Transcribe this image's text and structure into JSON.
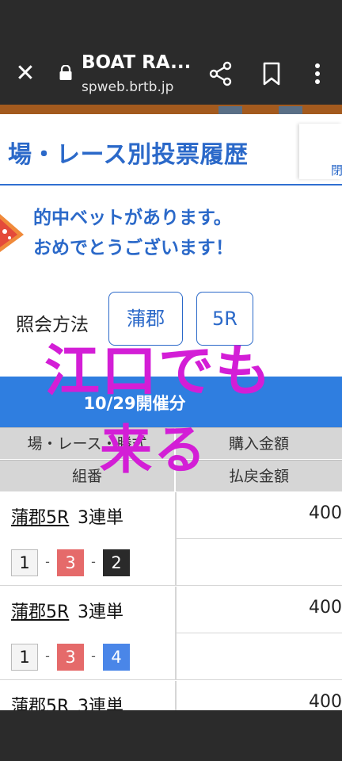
{
  "browser": {
    "title": "BOAT RA...",
    "url": "spweb.brtb.jp",
    "close_icon": "close-icon",
    "lock_icon": "lock-icon",
    "share_icon": "share-icon",
    "bookmark_icon": "bookmark-icon",
    "menu_icon": "more-vert-icon"
  },
  "page": {
    "title": "場・レース別投票履歴",
    "header_right_text": "閉"
  },
  "hit_message": {
    "line1": "的中ベットがあります。",
    "line2": "おめでとうございます！"
  },
  "query": {
    "label": "照会方法",
    "venue": "蒲郡",
    "race": "5R"
  },
  "date_bar": {
    "text": "10/29開催分"
  },
  "table": {
    "header_row1": {
      "left": "場・レース・勝式",
      "right": "購入金額"
    },
    "header_row2": {
      "left": "組番",
      "right": "払戻金額"
    },
    "rows": [
      {
        "race": "蒲郡5R",
        "bet_type": "3連単",
        "amount": "400",
        "combo": [
          "1",
          "3",
          "2"
        ]
      },
      {
        "race": "蒲郡5R",
        "bet_type": "3連単",
        "amount": "400",
        "combo": [
          "1",
          "3",
          "4"
        ]
      },
      {
        "race": "蒲郡5R",
        "bet_type": "3連単",
        "amount": "400"
      }
    ]
  },
  "overlay_text": {
    "line1": "江口でも",
    "line2": "来る"
  },
  "colors": {
    "accent_blue": "#2b69c9",
    "date_bar": "#2f7ee0",
    "overlay_magenta": "#d31ed6",
    "boat1": "#f4f4f4",
    "boat2": "#2a2a2a",
    "boat3": "#e56a6a",
    "boat4": "#4a86e8"
  }
}
